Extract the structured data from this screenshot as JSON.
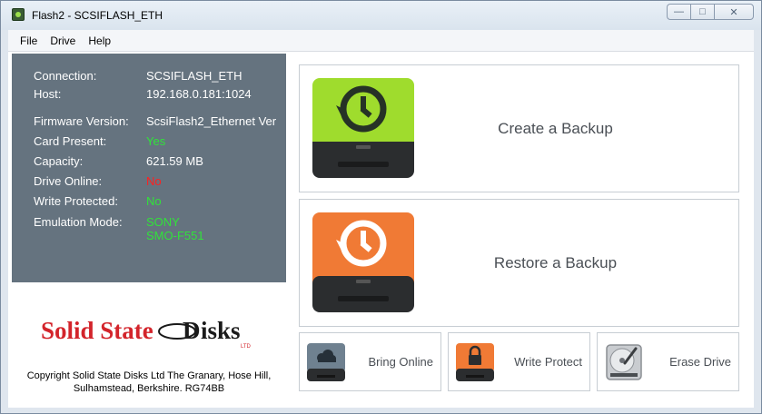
{
  "window": {
    "title": "Flash2 - SCSIFLASH_ETH",
    "controls": {
      "minimize": "—",
      "maximize": "□",
      "close": "✕"
    }
  },
  "menu": {
    "items": [
      "File",
      "Drive",
      "Help"
    ]
  },
  "info": {
    "connection_label": "Connection:",
    "connection_value": "SCSIFLASH_ETH",
    "host_label": "Host:",
    "host_value": "192.168.0.181:1024",
    "firmware_label": "Firmware Version:",
    "firmware_value": "ScsiFlash2_Ethernet Ver",
    "card_present_label": "Card Present:",
    "card_present_value": "Yes",
    "capacity_label": "Capacity:",
    "capacity_value": "621.59 MB",
    "drive_online_label": "Drive Online:",
    "drive_online_value": "No",
    "write_protected_label": "Write Protected:",
    "write_protected_value": "No",
    "emulation_label": "Emulation Mode:",
    "emulation_value_line1": "SONY",
    "emulation_value_line2": "SMO-F551"
  },
  "logo": {
    "text_part1": "Solid State",
    "text_part2": "isks",
    "letter_d": "D",
    "ltd": "LTD"
  },
  "copyright": {
    "line1": "Copyright Solid State Disks Ltd The Granary, Hose Hill,",
    "line2": "Sulhamstead, Berkshire. RG74BB"
  },
  "actions": {
    "create_backup": "Create a Backup",
    "restore_backup": "Restore a Backup",
    "bring_online": "Bring Online",
    "write_protect": "Write Protect",
    "erase_drive": "Erase Drive"
  },
  "colors": {
    "info_panel_bg": "#65737f",
    "status_yes": "#31e23a",
    "status_no": "#ff2020",
    "create_drive": "#9fdc2d",
    "restore_drive": "#f07a35",
    "logo_red": "#d3242b"
  },
  "icons": {
    "app": "app-icon",
    "create": "green-drive-clock-icon",
    "restore": "orange-drive-restore-icon",
    "online": "cloud-drive-icon",
    "protect": "lock-drive-icon",
    "erase": "hard-disk-icon"
  }
}
